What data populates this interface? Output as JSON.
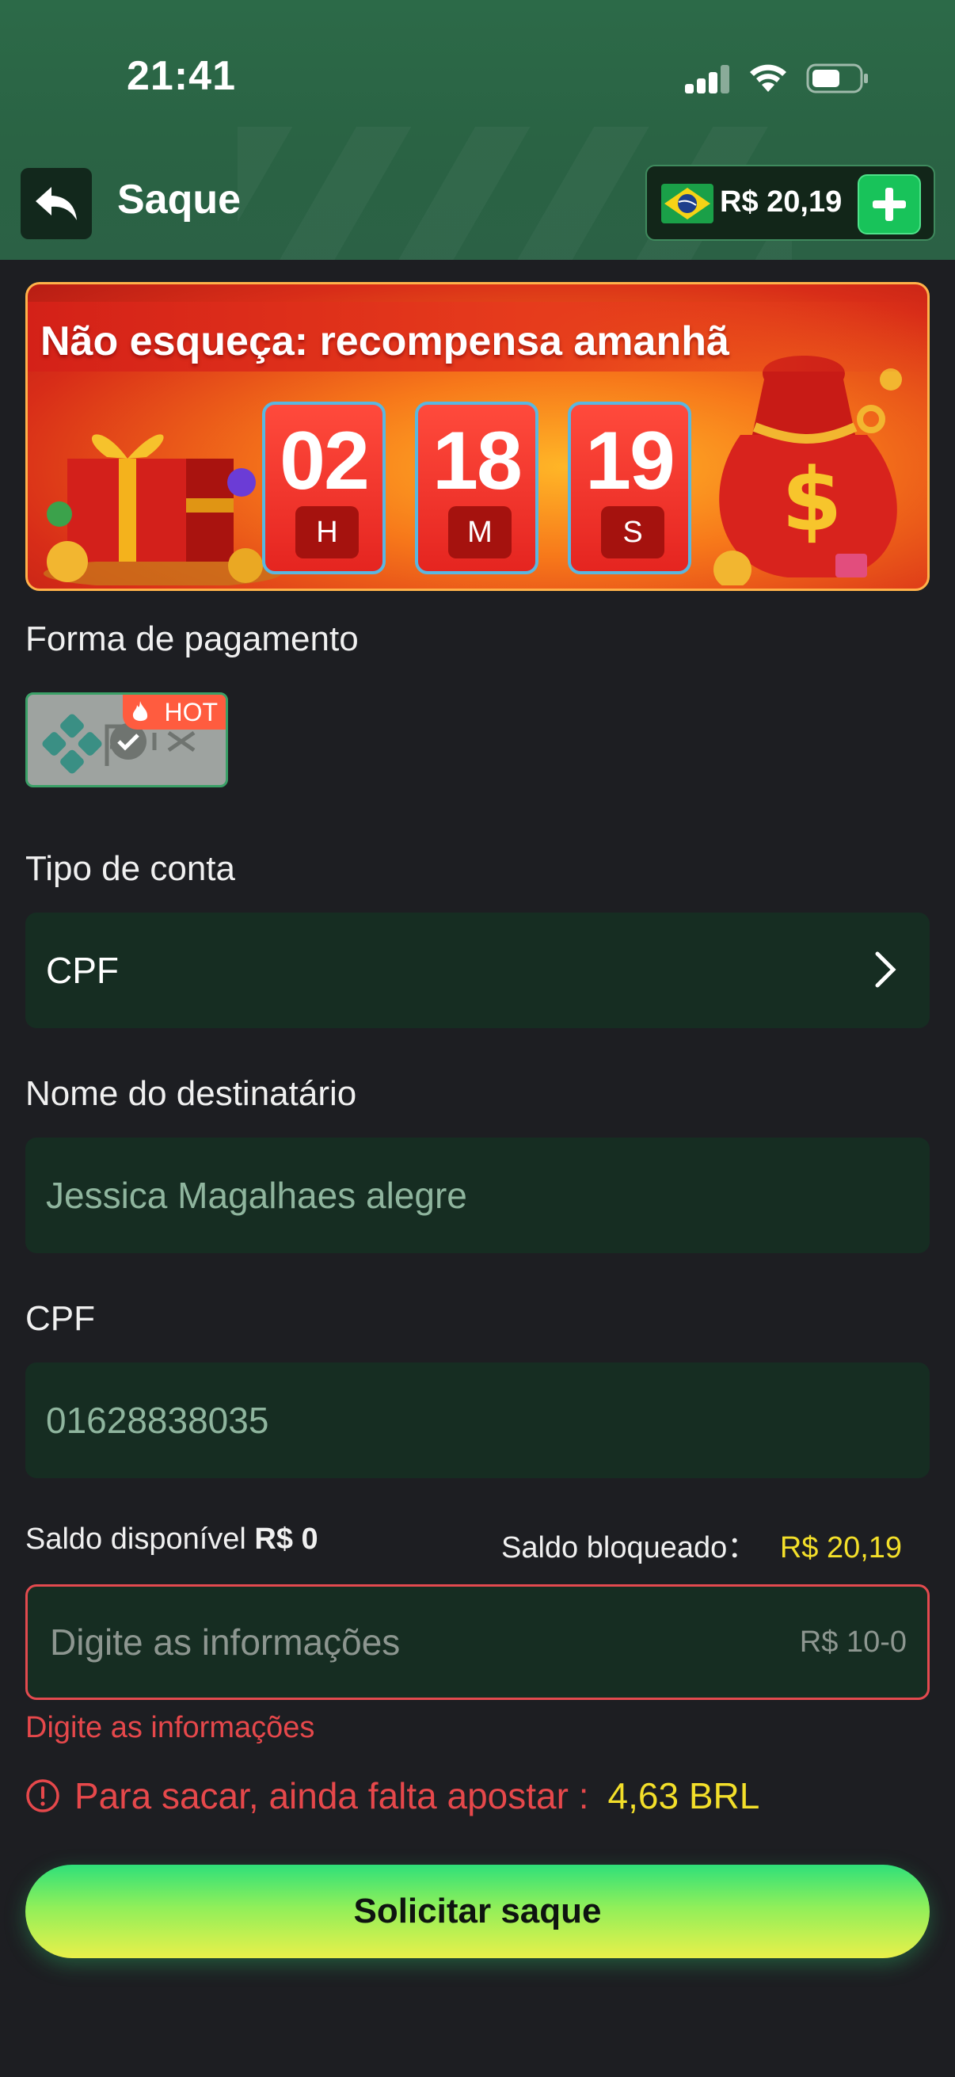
{
  "status_bar": {
    "time": "21:41"
  },
  "header": {
    "title": "Saque",
    "balance": "R$ 20,19"
  },
  "banner": {
    "title": "Não esqueça: recompensa amanhã",
    "timer": [
      {
        "value": "02",
        "unit": "H"
      },
      {
        "value": "18",
        "unit": "M"
      },
      {
        "value": "19",
        "unit": "S"
      }
    ]
  },
  "payment": {
    "label": "Forma de pagamento",
    "method": "pix",
    "badge": "HOT"
  },
  "account_type": {
    "label": "Tipo de conta",
    "value": "CPF"
  },
  "recipient": {
    "label": "Nome do destinatário",
    "value": "Jessica Magalhaes alegre"
  },
  "cpf": {
    "label": "CPF",
    "value": "01628838035"
  },
  "saldo": {
    "available_label": "Saldo disponível",
    "available_value": "R$ 0",
    "blocked_label": "Saldo bloqueado：",
    "blocked_value": "R$ 20,19"
  },
  "amount": {
    "placeholder": "Digite as informações",
    "range": "R$ 10-0",
    "error": "Digite as informações"
  },
  "warning": {
    "text": "Para sacar, ainda falta apostar :",
    "amount": "4,63 BRL"
  },
  "submit": {
    "label": "Solicitar saque"
  },
  "colors": {
    "accent_green": "#18c35a",
    "error_red": "#e6484b",
    "highlight_yellow": "#f3df2a",
    "field_bg": "#162d22"
  }
}
